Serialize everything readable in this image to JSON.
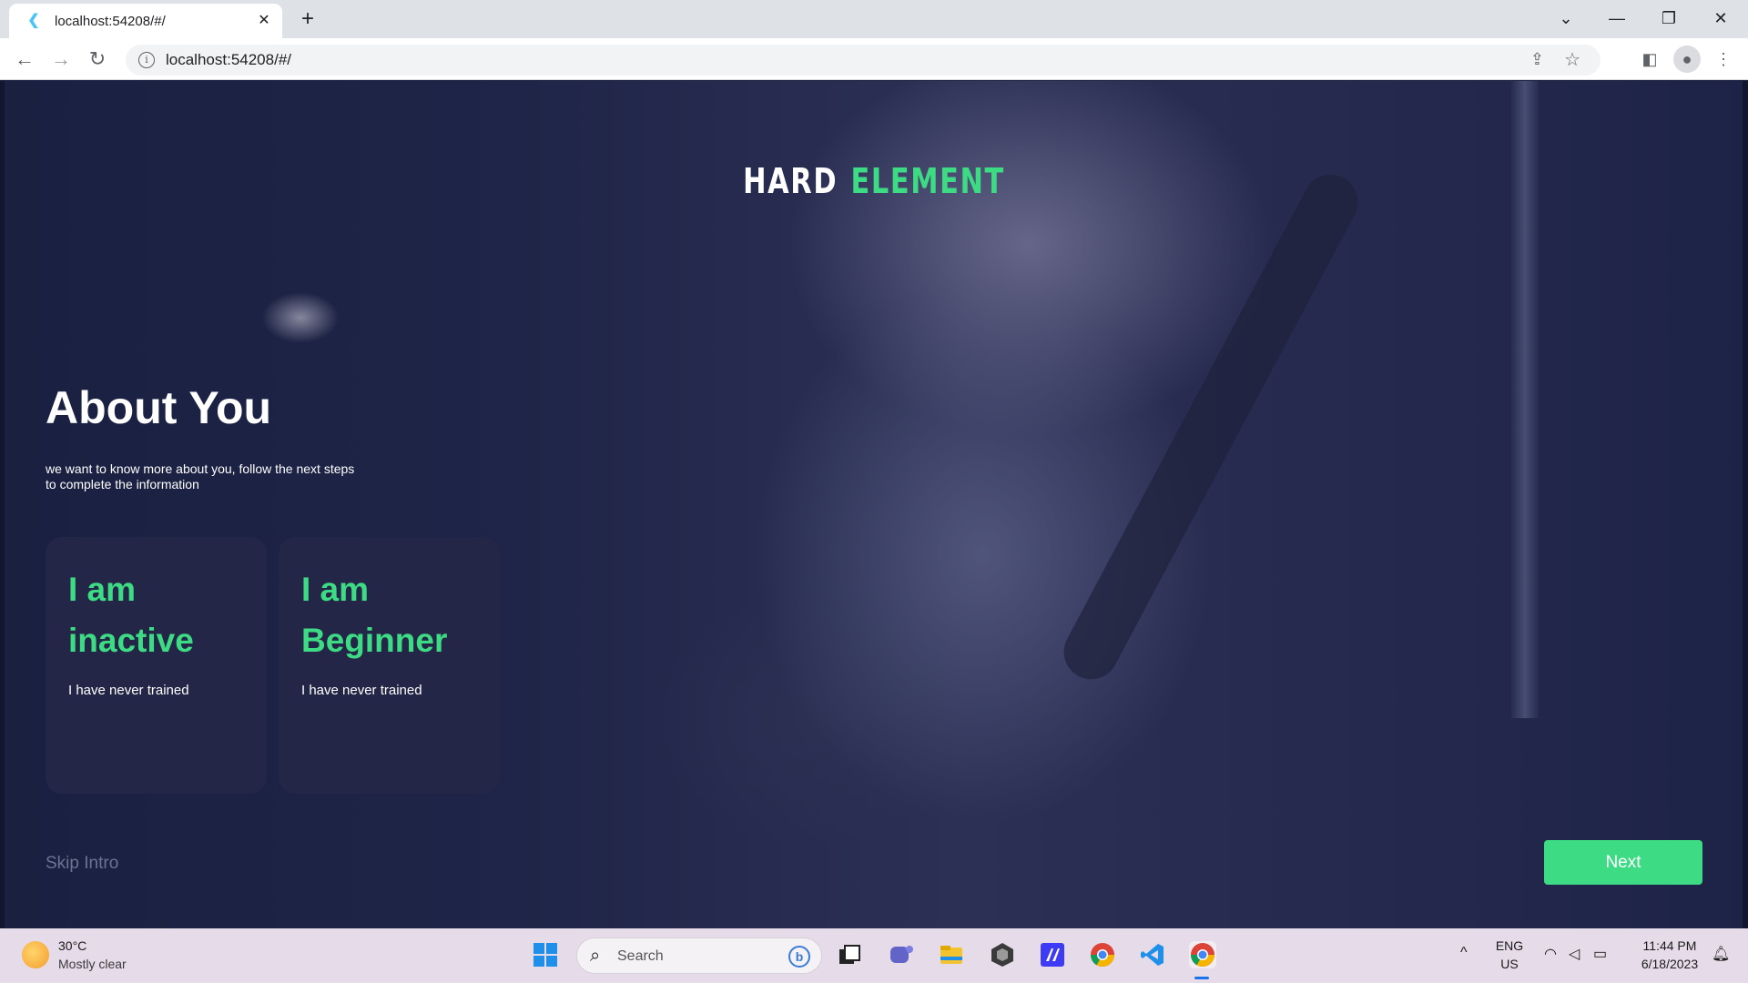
{
  "browser": {
    "tab_title": "localhost:54208/#/",
    "tab_close": "✕",
    "new_tab": "+",
    "url": "localhost:54208/#/",
    "window_controls": {
      "dropdown": "⌄",
      "minimize": "—",
      "restore": "❐",
      "close": "✕"
    },
    "nav": {
      "back": "←",
      "forward": "→",
      "reload": "↻"
    }
  },
  "app": {
    "brand": {
      "word1": "HARD",
      "word2": "ELEMENT"
    },
    "heading": "About You",
    "subtitle": "we want to know more about you, follow the next steps\n to complete the information",
    "cards": [
      {
        "title": "I am\ninactive",
        "description": "I have never trained"
      },
      {
        "title": "I am\nBeginner",
        "description": "I have never trained"
      }
    ],
    "skip_label": "Skip Intro",
    "next_label": "Next",
    "colors": {
      "accent": "#3ddc84",
      "card_bg": "#242647",
      "muted": "#6e7393"
    }
  },
  "taskbar": {
    "weather": {
      "temp": "30°C",
      "condition": "Mostly clear"
    },
    "search_placeholder": "Search",
    "tray": {
      "lang1": "ENG",
      "lang2": "US",
      "time": "11:44 PM",
      "date": "6/18/2023",
      "chevron": "^"
    }
  }
}
